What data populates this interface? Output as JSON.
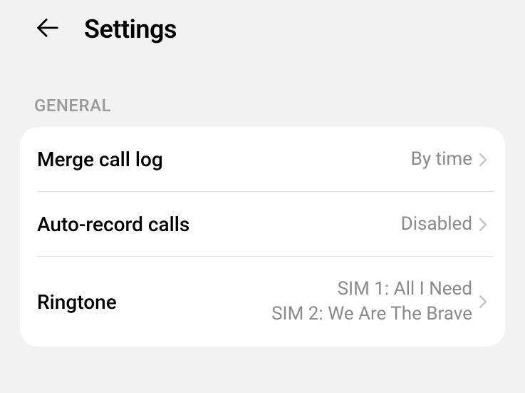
{
  "header": {
    "title": "Settings"
  },
  "section": {
    "label": "GENERAL"
  },
  "rows": {
    "merge_call_log": {
      "label": "Merge call log",
      "value": "By time"
    },
    "auto_record": {
      "label": "Auto-record calls",
      "value": "Disabled"
    },
    "ringtone": {
      "label": "Ringtone",
      "line1": "SIM 1: All I Need",
      "line2": "SIM 2: We Are The Brave"
    }
  }
}
